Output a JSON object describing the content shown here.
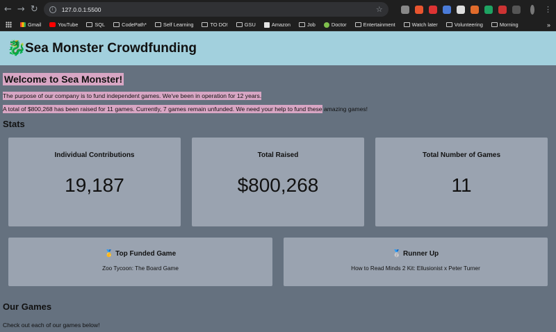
{
  "browser": {
    "url": "127.0.0.1:5500",
    "bookmarks": [
      "Gmail",
      "YouTube",
      "SQL",
      "CodePath*",
      "Self Learning",
      "TO DO!",
      "GSU",
      "Amazon",
      "Job",
      "Doctor",
      "Entertainment",
      "Watch later",
      "Volunteering",
      "Morning"
    ]
  },
  "header": {
    "title": "Sea Monster Crowdfunding",
    "logo_glyph": "🐉"
  },
  "intro": {
    "welcome": "Welcome to Sea Monster!",
    "purpose": "The purpose of our company is to fund independent games. We've been in operation for 12 years.",
    "summary_highlighted": "A total of $800,268 has been raised for 11 games. Currently, 7 games remain unfunded. We need your help to fund these",
    "summary_rest": " amazing games!"
  },
  "stats": {
    "section_title": "Stats",
    "contributions": {
      "label": "Individual Contributions",
      "value": "19,187"
    },
    "raised": {
      "label": "Total Raised",
      "value": "$800,268"
    },
    "games": {
      "label": "Total Number of Games",
      "value": "11"
    }
  },
  "top_games": {
    "first": {
      "label": "🥇 Top Funded Game",
      "name": "Zoo Tycoon: The Board Game"
    },
    "second": {
      "label": "🥈 Runner Up",
      "name": "How to Read Minds 2 Kit: Ellusionist x Peter Turner"
    }
  },
  "our_games": {
    "title": "Our Games",
    "subtitle": "Check out each of our games below!"
  }
}
